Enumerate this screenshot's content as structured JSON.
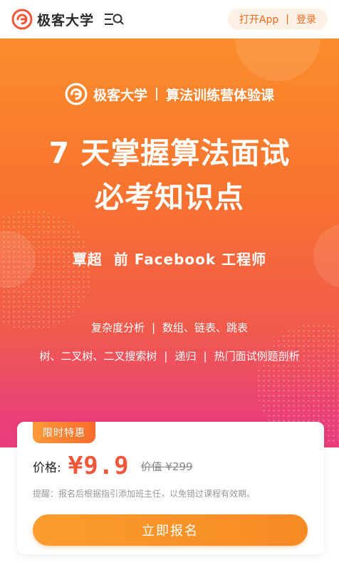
{
  "header": {
    "brand_name": "极客大学",
    "open_app": "打开App",
    "separator": "|",
    "login": "登录"
  },
  "hero": {
    "sub_brand_name": "极客大学",
    "sub_brand_course": "算法训练营体验课",
    "title_line1": "7 天掌握算法面试",
    "title_line2": "必考知识点",
    "instructor": "覃超  前 Facebook 工程师",
    "topics_row1": [
      "复杂度分析",
      "数组、链表、跳表"
    ],
    "topics_row2": [
      "树、二叉树、二叉搜索树",
      "递归",
      "热门面试例题剖析"
    ],
    "topic_separator": "|"
  },
  "offer": {
    "tag": "限时特惠",
    "price_label": "价格:",
    "price_current": "¥9.9",
    "price_original": "价值 ¥299",
    "notice": "提醒：报名后根据指引添加班主任，以免错过课程有效期。",
    "cta_label": "立即报名"
  },
  "colors": {
    "accent": "#f26a1d",
    "price": "#f0563a",
    "gradient_top": "#fb8d2c",
    "gradient_bottom": "#e53a86"
  },
  "icons": {
    "logo": "geekbang-logo-icon",
    "menu": "menu-search-icon"
  }
}
